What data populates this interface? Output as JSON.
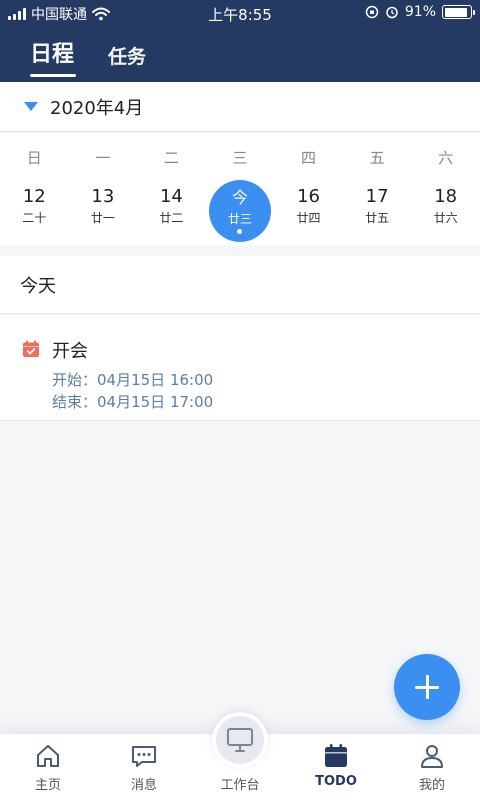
{
  "status_bar": {
    "carrier": "中国联通",
    "time": "上午8:55",
    "battery_percent": "91%",
    "battery_level": 0.91
  },
  "header": {
    "tabs": [
      {
        "label": "日程",
        "active": true
      },
      {
        "label": "任务",
        "active": false
      }
    ]
  },
  "calendar": {
    "month_label": "2020年4月",
    "weekdays": [
      "日",
      "一",
      "二",
      "三",
      "四",
      "五",
      "六"
    ],
    "days": [
      {
        "num": "12",
        "lunar": "二十"
      },
      {
        "num": "13",
        "lunar": "廿一"
      },
      {
        "num": "14",
        "lunar": "廿二"
      },
      {
        "num": "今",
        "lunar": "廿三",
        "selected": true,
        "has_event": true
      },
      {
        "num": "16",
        "lunar": "廿四"
      },
      {
        "num": "17",
        "lunar": "廿五"
      },
      {
        "num": "18",
        "lunar": "廿六"
      }
    ]
  },
  "list": {
    "section_title": "今天",
    "events": [
      {
        "title": "开会",
        "start": "开始：04月15日 16:00",
        "end": "结束：04月15日 17:00"
      }
    ]
  },
  "bottom_nav": {
    "items": [
      {
        "label": "主页",
        "icon": "home-icon"
      },
      {
        "label": "消息",
        "icon": "message-icon"
      },
      {
        "label": "工作台",
        "icon": "monitor-icon"
      },
      {
        "label": "TODO",
        "icon": "calendar-icon",
        "active": true
      },
      {
        "label": "我的",
        "icon": "user-icon"
      }
    ]
  },
  "colors": {
    "header_bg": "#243a63",
    "accent": "#3b8ff0",
    "event_icon": "#f26b5b"
  }
}
